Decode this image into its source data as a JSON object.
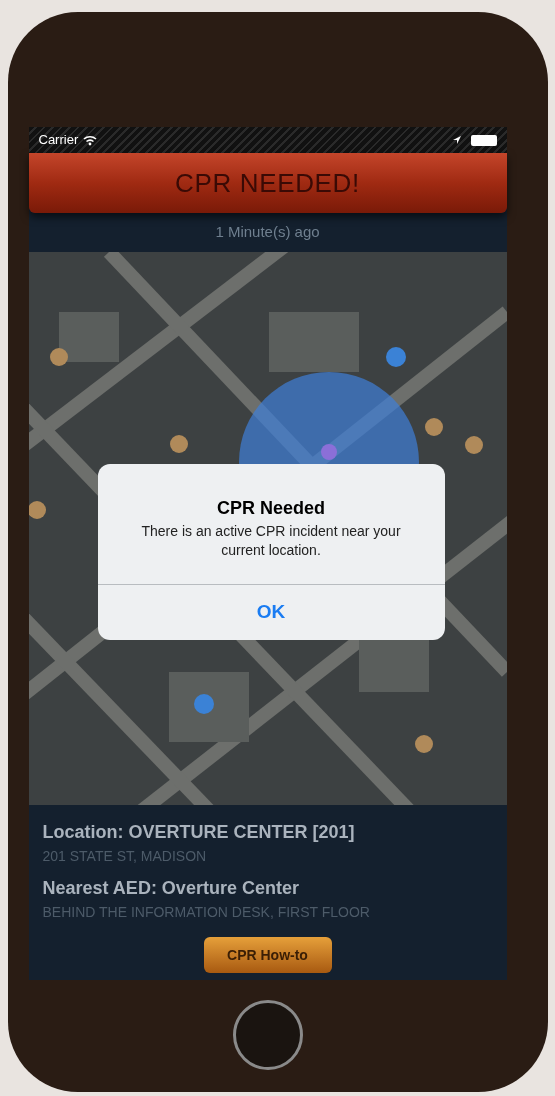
{
  "status_bar": {
    "carrier": "Carrier"
  },
  "header": {
    "title": "CPR NEEDED!"
  },
  "elapsed": "1 Minute(s) ago",
  "alert": {
    "title": "CPR Needed",
    "message": "There is an active CPR incident near your current location.",
    "button": "OK"
  },
  "details": [
    {
      "label": "Location: OVERTURE CENTER [201]",
      "sublabel": "201 STATE ST, MADISON"
    },
    {
      "label": "Nearest AED: Overture Center",
      "sublabel": "BEHIND THE INFORMATION DESK, FIRST FLOOR"
    }
  ],
  "action_button": "CPR How-to"
}
